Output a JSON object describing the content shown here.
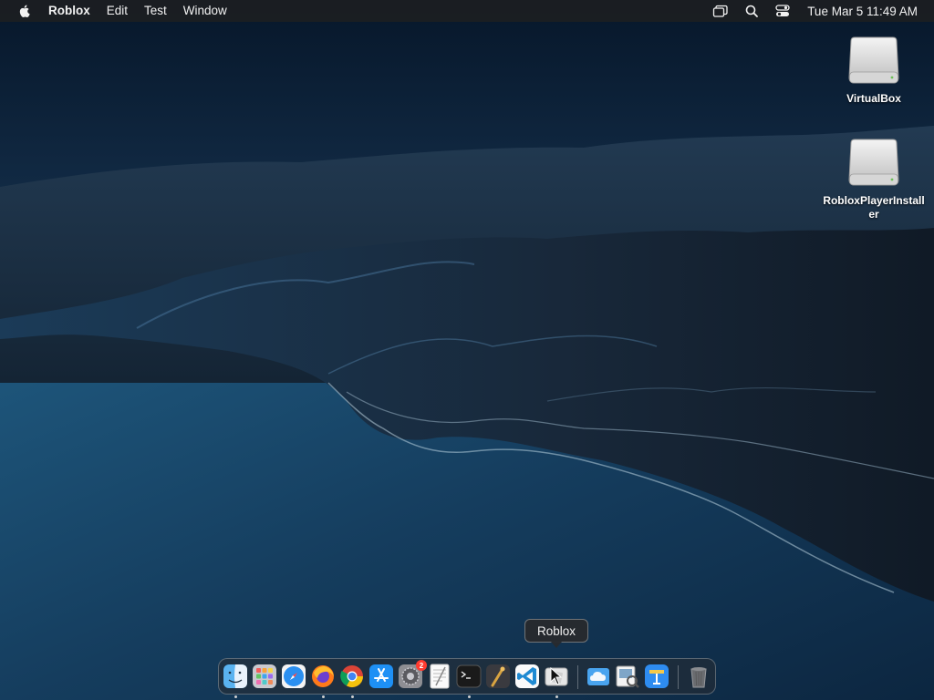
{
  "menubar": {
    "app_name": "Roblox",
    "items": [
      {
        "label": "Edit"
      },
      {
        "label": "Test"
      },
      {
        "label": "Window"
      }
    ],
    "clock": "Tue Mar 5  11:49 AM",
    "status_icons": [
      "screen-mirroring-icon",
      "spotlight-search-icon",
      "control-center-icon"
    ]
  },
  "desktop": {
    "icons": [
      {
        "label": "VirtualBox",
        "icon": "disk-image-icon"
      },
      {
        "label": "RobloxPlayerInstaller",
        "icon": "disk-image-icon"
      }
    ]
  },
  "tooltip": {
    "text": "Roblox"
  },
  "dock": {
    "apps": [
      {
        "name": "Finder",
        "icon": "finder-icon",
        "running": true
      },
      {
        "name": "Launchpad",
        "icon": "launchpad-icon",
        "running": false
      },
      {
        "name": "Safari",
        "icon": "safari-icon",
        "running": false
      },
      {
        "name": "Firefox",
        "icon": "firefox-icon",
        "running": true
      },
      {
        "name": "Google Chrome",
        "icon": "chrome-icon",
        "running": true
      },
      {
        "name": "App Store",
        "icon": "app-store-icon",
        "running": false
      },
      {
        "name": "System Settings",
        "icon": "system-settings-icon",
        "running": false,
        "badge": "2"
      },
      {
        "name": "TextEdit",
        "icon": "textedit-icon",
        "running": false
      },
      {
        "name": "Terminal",
        "icon": "terminal-icon",
        "running": true
      },
      {
        "name": "Instruments",
        "icon": "instruments-icon",
        "running": false
      },
      {
        "name": "Visual Studio Code",
        "icon": "vscode-icon",
        "running": false
      },
      {
        "name": "Roblox",
        "icon": "roblox-icon",
        "running": true
      },
      {
        "name": "iCloud Drive",
        "icon": "cloud-folder-icon",
        "running": false
      },
      {
        "name": "Preview",
        "icon": "preview-icon",
        "running": false
      },
      {
        "name": "Keynote",
        "icon": "keynote-icon",
        "running": false
      },
      {
        "name": "Trash",
        "icon": "trash-icon",
        "running": false
      }
    ]
  },
  "colors": {
    "menubar_bg": "#1c1e22",
    "sky_top": "#0a1a2e",
    "sea": "#1c4a6e",
    "badge": "#ff3b30"
  }
}
